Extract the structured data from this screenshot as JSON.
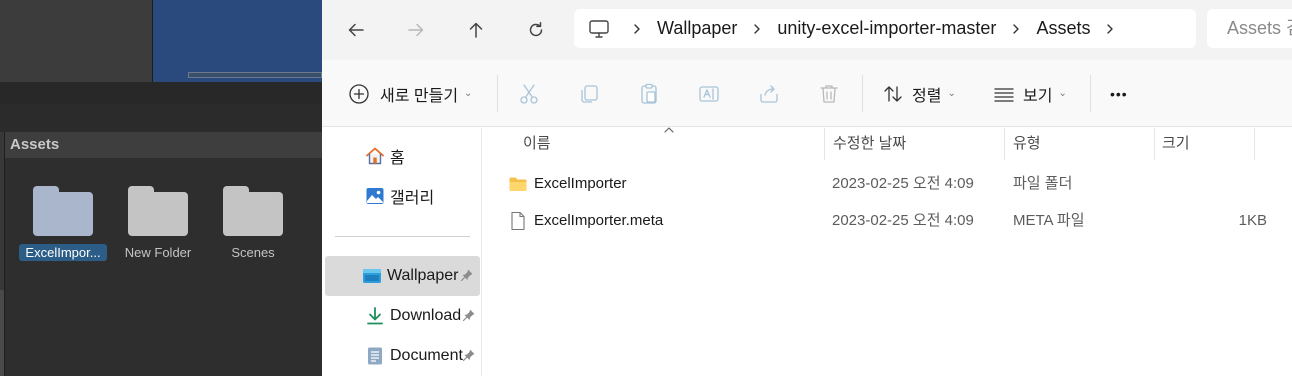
{
  "unity": {
    "panel_title": "Assets",
    "assets": [
      {
        "label": "ExcelImpor...",
        "selected": true
      },
      {
        "label": "New Folder",
        "selected": false
      },
      {
        "label": "Scenes",
        "selected": false
      }
    ]
  },
  "address": {
    "crumbs": [
      "Wallpaper",
      "unity-excel-importer-master",
      "Assets"
    ],
    "search_placeholder": "Assets 검"
  },
  "toolbar": {
    "new_label": "새로 만들기",
    "sort_label": "정렬",
    "view_label": "보기",
    "more_label": "•••"
  },
  "nav": {
    "home": "홈",
    "gallery": "갤러리",
    "pinned": [
      "Wallpaper",
      "Download",
      "Document"
    ]
  },
  "columns": {
    "name": "이름",
    "date": "수정한 날짜",
    "type": "유형",
    "size": "크기"
  },
  "files": [
    {
      "name": "ExcelImporter",
      "date": "2023-02-25 오전 4:09",
      "type": "파일 폴더",
      "size": "",
      "kind": "folder"
    },
    {
      "name": "ExcelImporter.meta",
      "date": "2023-02-25 오전 4:09",
      "type": "META 파일",
      "size": "1KB",
      "kind": "file"
    }
  ],
  "colors": {
    "unity_bg": "#383838",
    "unity_selection": "#2c5d87",
    "explorer_selection": "#dadada",
    "folder_yellow": "#f4c04c"
  }
}
